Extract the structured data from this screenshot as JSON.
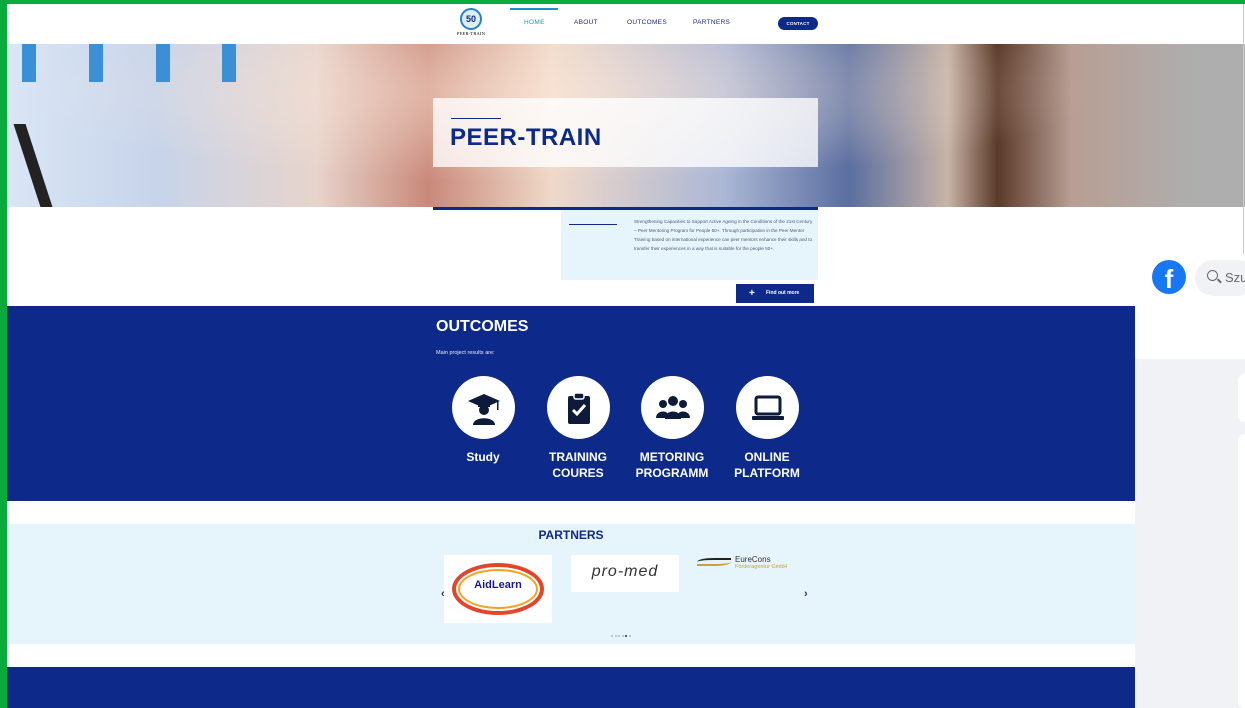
{
  "nav": {
    "logo_number": "50",
    "logo_text": "PEER-TRAIN",
    "items": [
      "HOME",
      "ABOUT",
      "OUTCOMES",
      "PARTNERS"
    ],
    "contact": "CONTACT"
  },
  "hero": {
    "title": "PEER-TRAIN"
  },
  "description": {
    "text": "Strengthening Capacities to Support Active Ageing in the Conditions of the 21st Century – Peer Mentoring Program for People 50+. Through participation in the Peer Mentor Training based on international experience can peer mentors enhance their skills and to transfer their experiences in a way that is suitable for the people 50+.",
    "button_icon": "+",
    "button": "Find out more"
  },
  "outcomes": {
    "title": "OUTCOMES",
    "subtitle": "Main project results are:",
    "items": [
      {
        "label": "Study",
        "icon": "graduate-icon"
      },
      {
        "label": "TRAINING COURES",
        "icon": "clipboard-check-icon"
      },
      {
        "label": "METORING PROGRAMM",
        "icon": "group-icon"
      },
      {
        "label": "ONLINE PLATFORM",
        "icon": "laptop-icon"
      }
    ]
  },
  "partners": {
    "title": "PARTNERS",
    "logos": [
      "AidLearn",
      "pro-med",
      "EureCons",
      "Förderagentur GmbH"
    ],
    "prev": "‹",
    "next": "›"
  },
  "facebook": {
    "icon": "f",
    "search_placeholder": "Szu"
  },
  "colors": {
    "brand_blue": "#0d2a8a",
    "light_blue": "#e6f4fb",
    "frame_green": "#0aab3c",
    "facebook_blue": "#1877f2"
  }
}
